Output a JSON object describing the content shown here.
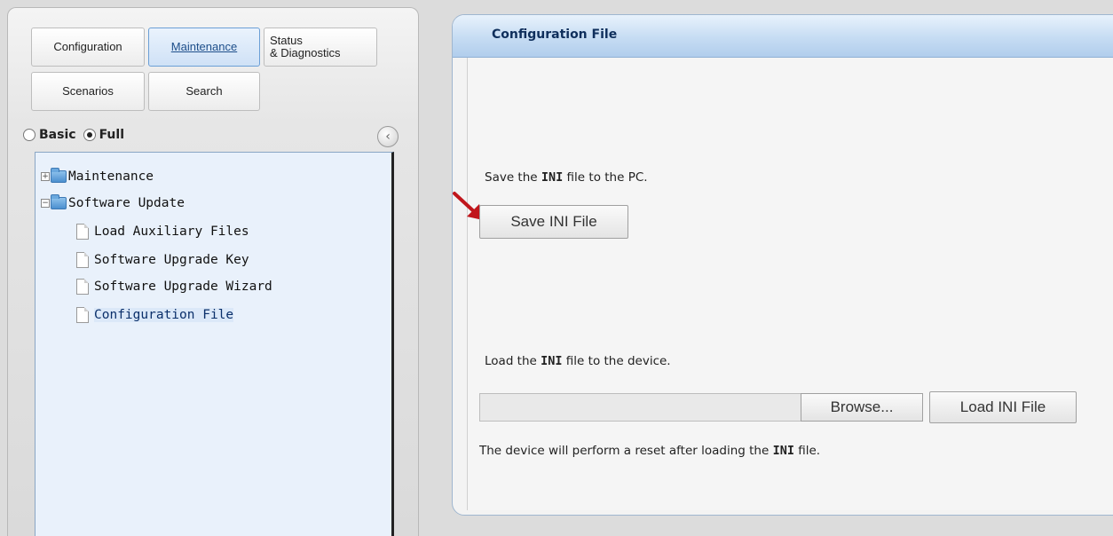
{
  "nav": {
    "tabs": [
      {
        "label": "Configuration"
      },
      {
        "label": "Maintenance"
      },
      {
        "line1": "Status",
        "line2": "& Diagnostics"
      },
      {
        "label": "Scenarios"
      },
      {
        "label": "Search"
      }
    ],
    "view_modes": {
      "basic": "Basic",
      "full": "Full",
      "selected": "Full"
    },
    "collapse_icon": "chevron-left-circle-icon"
  },
  "tree": {
    "items": [
      {
        "label": "Maintenance",
        "type": "folder",
        "state": "collapsed"
      },
      {
        "label": "Software Update",
        "type": "folder",
        "state": "expanded"
      },
      {
        "label": "Load Auxiliary Files",
        "type": "page"
      },
      {
        "label": "Software Upgrade Key",
        "type": "page"
      },
      {
        "label": "Software Upgrade Wizard",
        "type": "page"
      },
      {
        "label": "Configuration File",
        "type": "page",
        "selected": true
      }
    ]
  },
  "content": {
    "title": "Configuration File",
    "save": {
      "text_before": "Save the ",
      "text_bold": "INI",
      "text_after": " file to the PC.",
      "button": "Save INI File"
    },
    "load": {
      "text_before": "Load the ",
      "text_bold": "INI",
      "text_after": " file to the device.",
      "file_value": "",
      "browse_button": "Browse...",
      "load_button": "Load INI File"
    },
    "note": {
      "text_before": "The device will perform a reset after loading the ",
      "text_bold": "INI",
      "text_after": " file."
    }
  },
  "colors": {
    "accent": "#1d4e8a",
    "arrow": "#c0161c"
  }
}
